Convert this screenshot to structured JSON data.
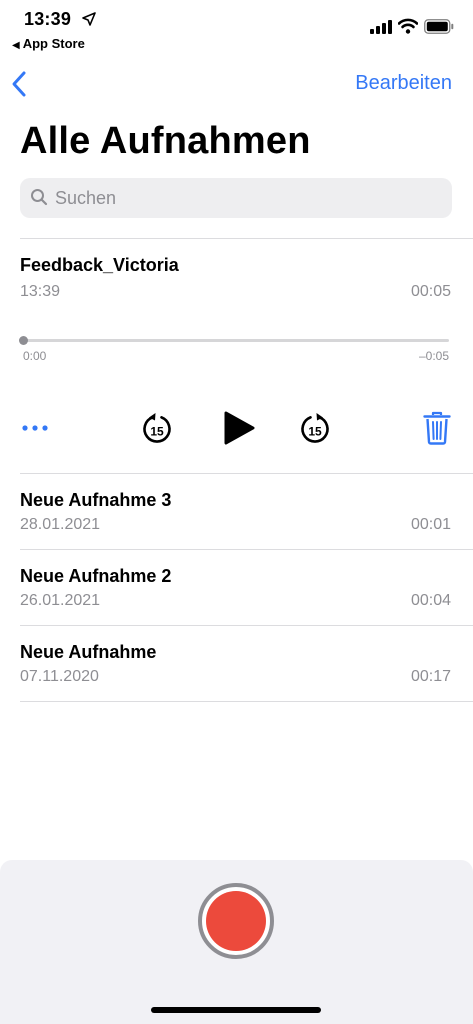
{
  "status_bar": {
    "time": "13:39",
    "back_app": "App Store"
  },
  "nav": {
    "edit_label": "Bearbeiten"
  },
  "title": "Alle Aufnahmen",
  "search": {
    "placeholder": "Suchen"
  },
  "expanded_recording": {
    "title": "Feedback_Victoria",
    "date": "13:39",
    "duration": "00:05",
    "elapsed": "0:00",
    "remaining": "–0:05",
    "skip_back_label": "15",
    "skip_forward_label": "15"
  },
  "recordings": [
    {
      "title": "Neue Aufnahme 3",
      "date": "28.01.2021",
      "duration": "00:01"
    },
    {
      "title": "Neue Aufnahme 2",
      "date": "26.01.2021",
      "duration": "00:04"
    },
    {
      "title": "Neue Aufnahme",
      "date": "07.11.2020",
      "duration": "00:17"
    }
  ],
  "colors": {
    "accent": "#3478f6",
    "record": "#ec4a3c",
    "secondary_text": "#8e8e93"
  },
  "icons": [
    "location-arrow-icon",
    "signal-icon",
    "wifi-icon",
    "battery-icon",
    "chevron-left-icon",
    "search-icon",
    "more-icon",
    "skip-back-15-icon",
    "play-icon",
    "skip-forward-15-icon",
    "trash-icon",
    "record-icon"
  ]
}
